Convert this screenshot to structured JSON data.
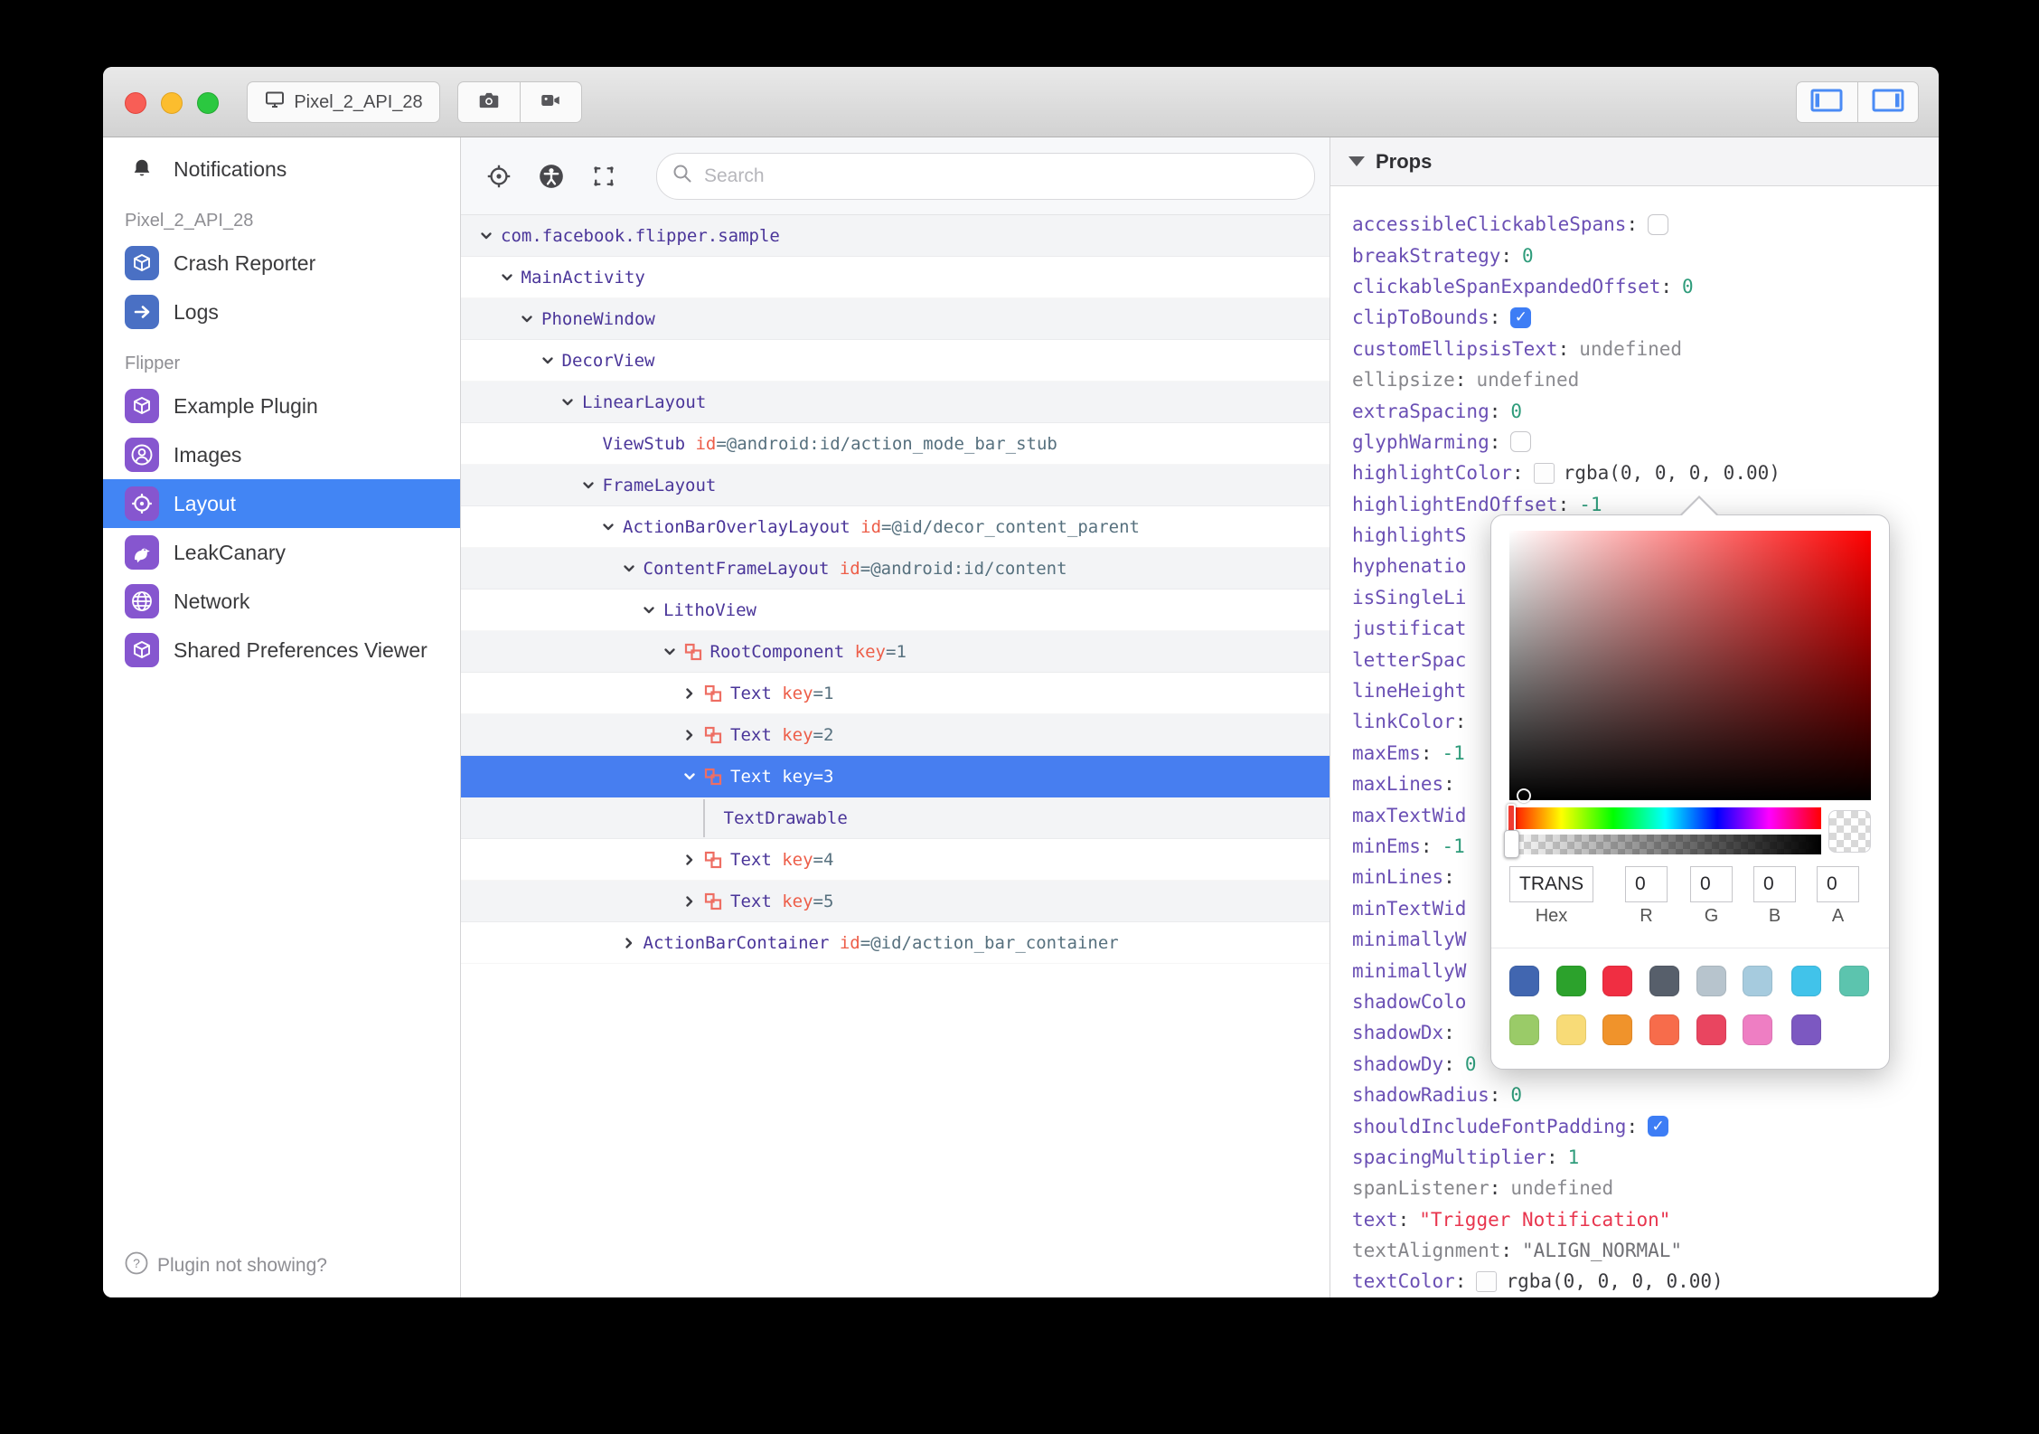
{
  "titlebar": {
    "device_button": "Pixel_2_API_28"
  },
  "sidebar": {
    "items": [
      {
        "label": "Notifications",
        "icon": "bell",
        "type": "plain"
      },
      {
        "label": "Pixel_2_API_28",
        "type": "section"
      },
      {
        "label": "Crash Reporter",
        "icon": "cube",
        "type": "blue"
      },
      {
        "label": "Logs",
        "icon": "arrow",
        "type": "blue"
      },
      {
        "label": "Flipper",
        "type": "section"
      },
      {
        "label": "Example Plugin",
        "icon": "cube",
        "type": "purple"
      },
      {
        "label": "Images",
        "icon": "person",
        "type": "purple"
      },
      {
        "label": "Layout",
        "icon": "target",
        "type": "purple",
        "selected": true
      },
      {
        "label": "LeakCanary",
        "icon": "bird",
        "type": "purple"
      },
      {
        "label": "Network",
        "icon": "globe",
        "type": "purple"
      },
      {
        "label": "Shared Preferences Viewer",
        "icon": "cube",
        "type": "purple"
      }
    ],
    "footer": "Plugin not showing?"
  },
  "toolbar": {
    "search_placeholder": "Search"
  },
  "tree": {
    "rows": [
      {
        "name": "com.facebook.flipper.sample",
        "indent": 0,
        "chevron": "down"
      },
      {
        "name": "MainActivity",
        "indent": 1,
        "chevron": "down"
      },
      {
        "name": "PhoneWindow",
        "indent": 2,
        "chevron": "down"
      },
      {
        "name": "DecorView",
        "indent": 3,
        "chevron": "down"
      },
      {
        "name": "LinearLayout",
        "indent": 4,
        "chevron": "down"
      },
      {
        "name": "ViewStub",
        "indent": 5,
        "chevron": "none",
        "attr_label": "id",
        "attr_rest": "=@android:id/action_mode_bar_stub"
      },
      {
        "name": "FrameLayout",
        "indent": 5,
        "chevron": "down"
      },
      {
        "name": "ActionBarOverlayLayout",
        "indent": 6,
        "chevron": "down",
        "attr_label": "id",
        "attr_rest": "=@id/decor_content_parent"
      },
      {
        "name": "ContentFrameLayout",
        "indent": 7,
        "chevron": "down",
        "attr_label": "id",
        "attr_rest": "=@android:id/content"
      },
      {
        "name": "LithoView",
        "indent": 8,
        "chevron": "down"
      },
      {
        "name": "RootComponent",
        "indent": 9,
        "chevron": "down",
        "litho": true,
        "attr_label": "key",
        "attr_rest": "=1"
      },
      {
        "name": "Text",
        "indent": 10,
        "chevron": "right",
        "litho": true,
        "attr_label": "key",
        "attr_rest": "=1"
      },
      {
        "name": "Text",
        "indent": 10,
        "chevron": "right",
        "litho": true,
        "attr_label": "key",
        "attr_rest": "=2"
      },
      {
        "name": "Text",
        "indent": 10,
        "chevron": "down",
        "litho": true,
        "attr_label": "key",
        "attr_rest": "=3",
        "selected": true
      },
      {
        "name": "TextDrawable",
        "indent": 11,
        "chevron": "none",
        "guide": true
      },
      {
        "name": "Text",
        "indent": 10,
        "chevron": "right",
        "litho": true,
        "attr_label": "key",
        "attr_rest": "=4"
      },
      {
        "name": "Text",
        "indent": 10,
        "chevron": "right",
        "litho": true,
        "attr_label": "key",
        "attr_rest": "=5"
      },
      {
        "name": "ActionBarContainer",
        "indent": 7,
        "chevron": "right",
        "attr_label": "id",
        "attr_rest": "=@id/action_bar_container"
      }
    ]
  },
  "props": {
    "header": "Props",
    "rows": [
      {
        "key": "accessibleClickableSpans",
        "colon": true,
        "type": "check_off"
      },
      {
        "key": "breakStrategy",
        "colon": true,
        "type": "num",
        "value": "0"
      },
      {
        "key": "clickableSpanExpandedOffset",
        "colon": true,
        "type": "num",
        "value": "0"
      },
      {
        "key": "clipToBounds",
        "colon": true,
        "type": "check_on"
      },
      {
        "key": "customEllipsisText",
        "colon": true,
        "type": "undef",
        "value": "undefined"
      },
      {
        "key": "ellipsize",
        "gray": true,
        "colon": true,
        "type": "undef",
        "value": "undefined"
      },
      {
        "key": "extraSpacing",
        "colon": true,
        "type": "num",
        "value": "0"
      },
      {
        "key": "glyphWarming",
        "colon": true,
        "type": "check_off"
      },
      {
        "key": "highlightColor",
        "colon": true,
        "type": "color",
        "value": "rgba(0, 0, 0, 0.00)"
      },
      {
        "key": "highlightEndOffset",
        "colon": true,
        "type": "num",
        "value": "-1"
      },
      {
        "key": "highlightS",
        "type": "none"
      },
      {
        "key": "hyphenatio",
        "type": "none"
      },
      {
        "key": "isSingleLi",
        "type": "none"
      },
      {
        "key": "justificat",
        "type": "none"
      },
      {
        "key": "letterSpac",
        "type": "none"
      },
      {
        "key": "lineHeight",
        "type": "none"
      },
      {
        "key": "linkColor",
        "colon": true,
        "type": "none"
      },
      {
        "key": "maxEms",
        "colon": true,
        "type": "num",
        "value": "-1"
      },
      {
        "key": "maxLines",
        "colon": true,
        "type": "none"
      },
      {
        "key": "maxTextWid",
        "type": "none"
      },
      {
        "key": "minEms",
        "colon": true,
        "type": "num",
        "value": "-1"
      },
      {
        "key": "minLines",
        "colon": true,
        "type": "none"
      },
      {
        "key": "minTextWid",
        "type": "none"
      },
      {
        "key": "minimallyW",
        "type": "none"
      },
      {
        "key": "minimallyW",
        "type": "none"
      },
      {
        "key": "shadowColo",
        "type": "none"
      },
      {
        "key": "shadowDx",
        "colon": true,
        "type": "none"
      },
      {
        "key": "shadowDy",
        "colon": true,
        "type": "num",
        "value": "0"
      },
      {
        "key": "shadowRadius",
        "colon": true,
        "type": "num",
        "value": "0"
      },
      {
        "key": "shouldIncludeFontPadding",
        "colon": true,
        "type": "check_on"
      },
      {
        "key": "spacingMultiplier",
        "colon": true,
        "type": "num",
        "value": "1"
      },
      {
        "key": "spanListener",
        "gray": true,
        "colon": true,
        "type": "undef",
        "value": "undefined"
      },
      {
        "key": "text",
        "colon": true,
        "type": "str",
        "value": "\"Trigger Notification\""
      },
      {
        "key": "textAlignment",
        "gray": true,
        "colon": true,
        "type": "gstr",
        "value": "\"ALIGN_NORMAL\""
      },
      {
        "key": "textColor",
        "colon": true,
        "type": "color",
        "value": "rgba(0, 0, 0, 0.00)"
      }
    ]
  },
  "picker": {
    "hex": "TRANS",
    "r": "0",
    "g": "0",
    "b": "0",
    "a": "0",
    "labels": {
      "hex": "Hex",
      "r": "R",
      "g": "G",
      "b": "B",
      "a": "A"
    },
    "swatches_row1": [
      "#4166b0",
      "#2ca22c",
      "#f02e42",
      "#575f6b",
      "#b7c4cd",
      "#a6cbde",
      "#41c3ea",
      "#5cc4ae"
    ],
    "swatches_row2": [
      "#9acb68",
      "#f8db77",
      "#f0932b",
      "#f76c4b",
      "#e94560",
      "#ee7ec3",
      "#7c58c1"
    ]
  }
}
